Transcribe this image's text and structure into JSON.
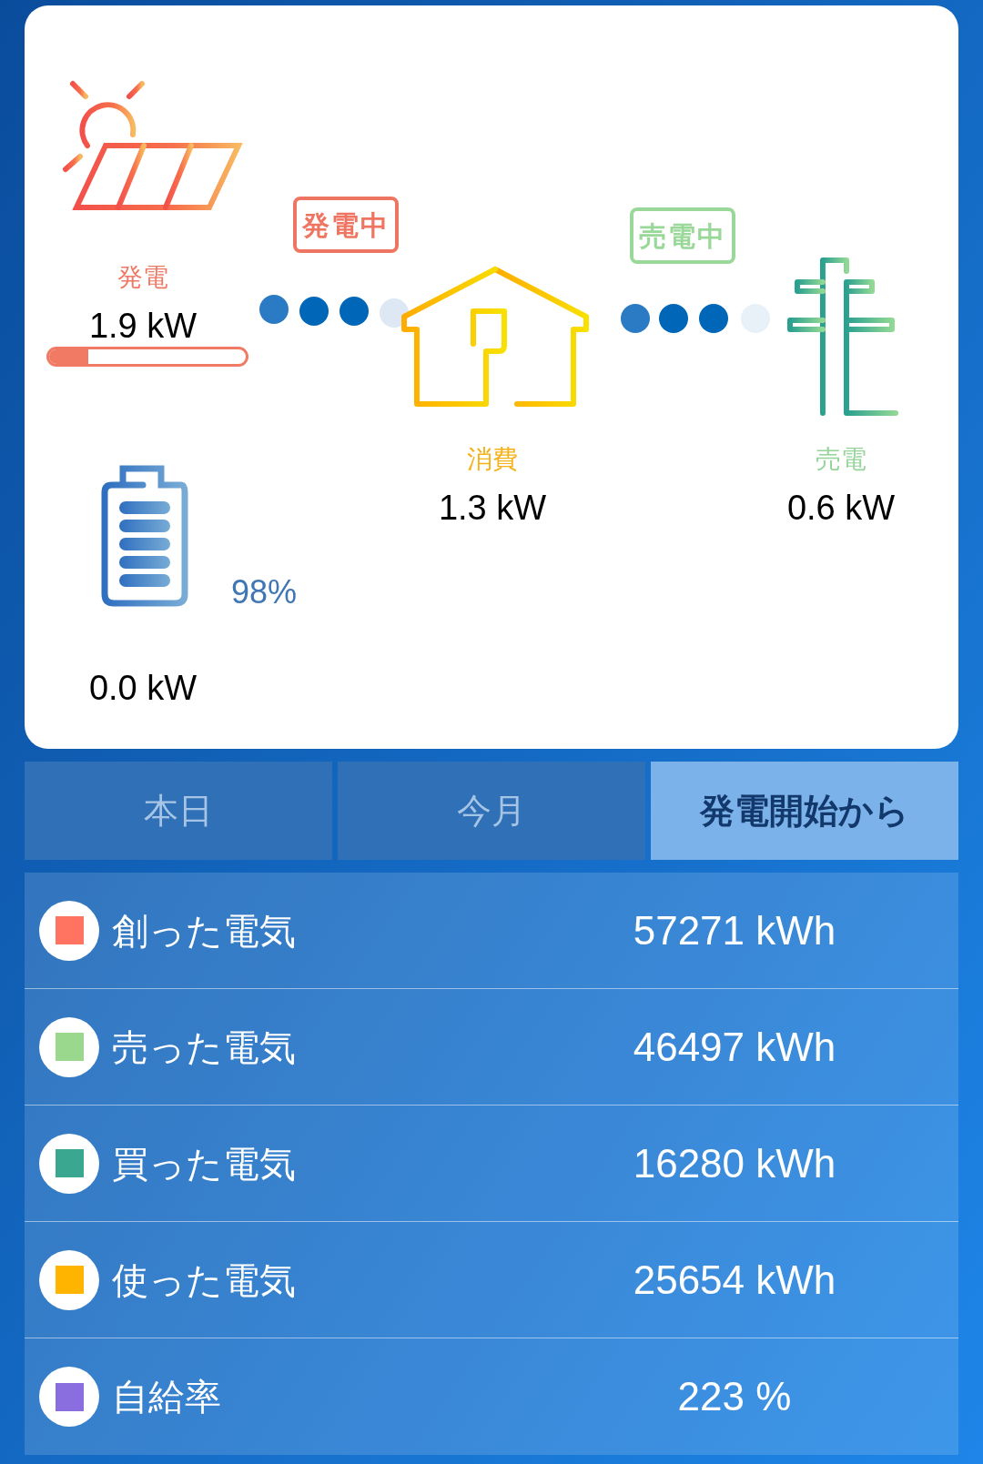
{
  "flow": {
    "generation": {
      "badge": "発電中",
      "label": "発電",
      "value": "1.9 kW",
      "level": 0.2
    },
    "consumption": {
      "label": "消費",
      "value": "1.3 kW"
    },
    "selling": {
      "badge": "売電中",
      "label": "売電",
      "value": "0.6 kW"
    },
    "battery": {
      "percent": "98%",
      "value": "0.0 kW"
    }
  },
  "tabs": [
    {
      "label": "本日",
      "selected": false
    },
    {
      "label": "今月",
      "selected": false
    },
    {
      "label": "発電開始から",
      "selected": true
    }
  ],
  "totals": [
    {
      "label": "創った電気",
      "value": "57271 kWh",
      "color": "#ff7360"
    },
    {
      "label": "売った電気",
      "value": "46497 kWh",
      "color": "#9ad88e"
    },
    {
      "label": "買った電気",
      "value": "16280 kWh",
      "color": "#3aa890"
    },
    {
      "label": "使った電気",
      "value": "25654 kWh",
      "color": "#ffb400"
    },
    {
      "label": "自給率",
      "value": "223 %",
      "color": "#8a6ee0"
    }
  ]
}
